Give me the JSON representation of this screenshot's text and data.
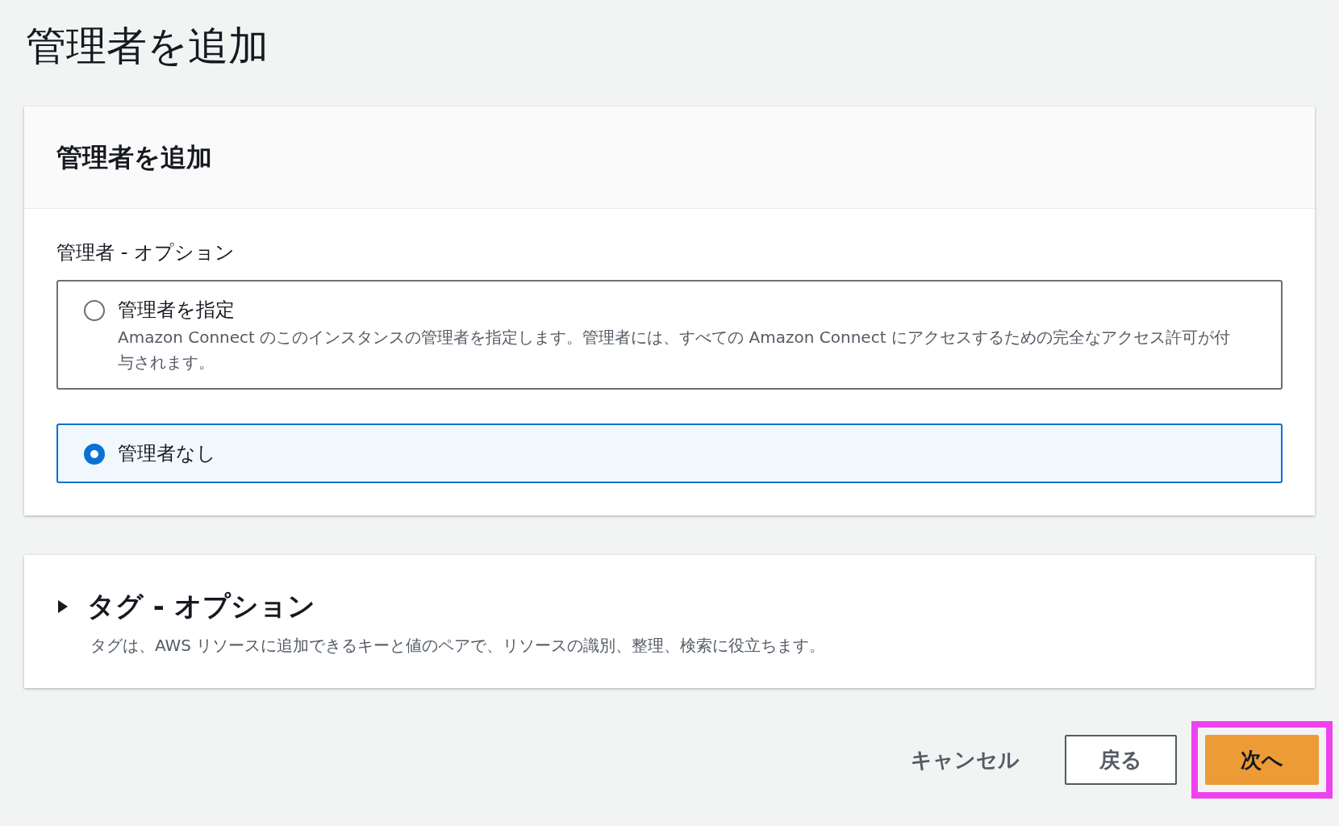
{
  "page_title": "管理者を追加",
  "admin_panel": {
    "title": "管理者を追加",
    "field_label": "管理者 - オプション",
    "options": [
      {
        "label": "管理者を指定",
        "description": "Amazon Connect のこのインスタンスの管理者を指定します。管理者には、すべての Amazon Connect にアクセスするための完全なアクセス許可が付与されます。",
        "selected": false
      },
      {
        "label": "管理者なし",
        "selected": true
      }
    ]
  },
  "tags_panel": {
    "title": "タグ - オプション",
    "expanded": false,
    "description": "タグは、AWS リソースに追加できるキーと値のペアで、リソースの識別、整理、検索に役立ちます。"
  },
  "buttons": [
    {
      "label": "キャンセル",
      "kind": "link",
      "highlighted": false
    },
    {
      "label": "戻る",
      "kind": "normal",
      "highlighted": false
    },
    {
      "label": "次へ",
      "kind": "primary",
      "highlighted": true
    }
  ]
}
